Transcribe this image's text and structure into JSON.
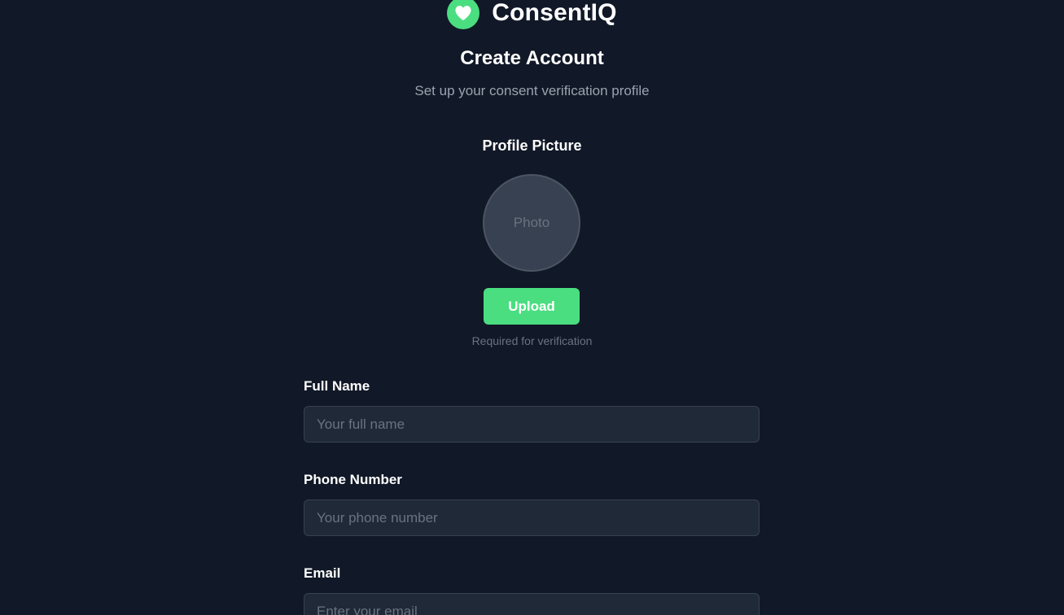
{
  "brand": {
    "name": "ConsentIQ",
    "icon": "heart-icon",
    "accent_color": "#4ade80"
  },
  "header": {
    "title": "Create Account",
    "subtitle": "Set up your consent verification profile"
  },
  "profile_picture": {
    "label": "Profile Picture",
    "placeholder_text": "Photo",
    "upload_label": "Upload",
    "helper_text": "Required for verification"
  },
  "form": {
    "full_name": {
      "label": "Full Name",
      "placeholder": "Your full name",
      "value": ""
    },
    "phone": {
      "label": "Phone Number",
      "placeholder": "Your phone number",
      "value": ""
    },
    "email": {
      "label": "Email",
      "placeholder": "Enter your email",
      "value": ""
    }
  },
  "colors": {
    "background": "#111827",
    "input_background": "#1f2937",
    "accent": "#4ade80",
    "muted_text": "#9ca3af"
  }
}
